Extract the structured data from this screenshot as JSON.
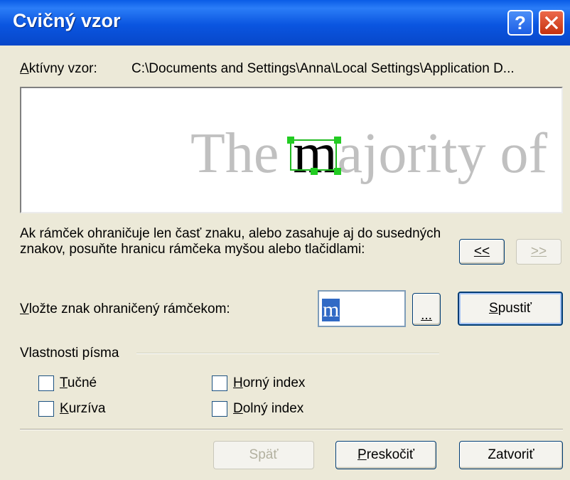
{
  "window": {
    "title": "Cvičný vzor",
    "help_glyph": "?",
    "close_glyph": "✕"
  },
  "active_pattern": {
    "label": "Aktívny vzor:",
    "path": "C:\\Documents and Settings\\Anna\\Local Settings\\Application D..."
  },
  "preview": {
    "before": "The ",
    "highlight": "m",
    "after": "ajority of"
  },
  "instructions": "Ak rámček ohraničuje len časť znaku, alebo zasahuje aj do susedných znakov, posuňte hranicu rámčeka myšou alebo tlačidlami:",
  "nav": {
    "prev": "<<",
    "next": ">>"
  },
  "char_entry": {
    "label": "Vložte znak ohraničený rámčekom:",
    "value": "m",
    "browse": "..."
  },
  "run_button": "Spustiť",
  "font_props": {
    "group_label": "Vlastnosti písma",
    "bold": "Tučné",
    "italic": "Kurzíva",
    "superscript": "Horný index",
    "subscript": "Dolný index"
  },
  "footer": {
    "back": "Späť",
    "skip": "Preskočiť",
    "close": "Zatvoriť"
  }
}
